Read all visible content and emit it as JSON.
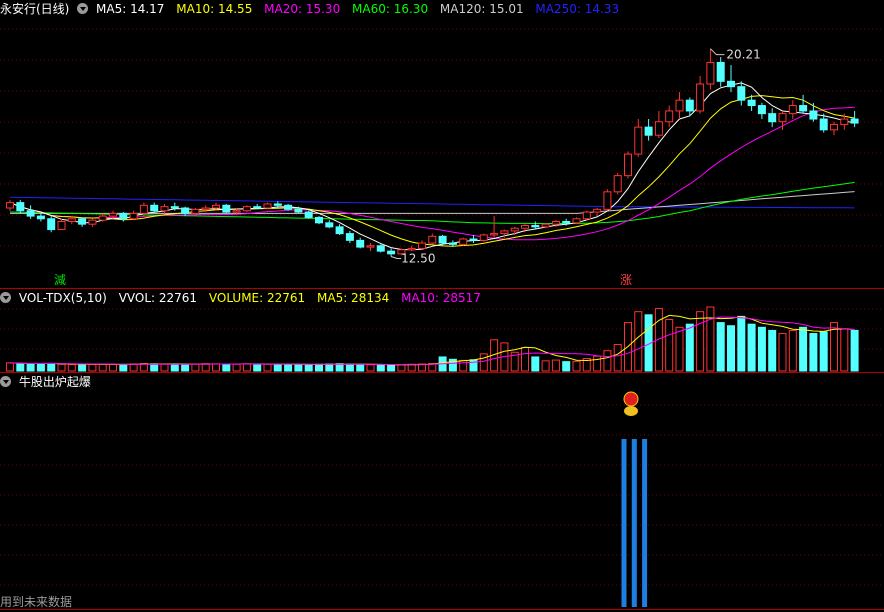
{
  "price_panel": {
    "title": "永安行(日线)",
    "indicators": [
      {
        "label": "MA5: 14.17",
        "color": "#ffffff"
      },
      {
        "label": "MA10: 14.55",
        "color": "#ffff00"
      },
      {
        "label": "MA20: 15.30",
        "color": "#ff00ff"
      },
      {
        "label": "MA60: 16.30",
        "color": "#00ff00"
      },
      {
        "label": "MA120: 15.01",
        "color": "#cccccc"
      },
      {
        "label": "MA250: 14.33",
        "color": "#2222ff"
      }
    ],
    "high_label": "20.21",
    "low_label": "12.50",
    "marker_down": "減",
    "marker_up": "涨"
  },
  "volume_panel": {
    "title": "VOL-TDX(5,10)",
    "indicators": [
      {
        "label": "VVOL: 22761",
        "color": "#ffffff"
      },
      {
        "label": "VOLUME: 22761",
        "color": "#ffff00"
      },
      {
        "label": "MA5: 28134",
        "color": "#ffff00"
      },
      {
        "label": "MA10: 28517",
        "color": "#ff00ff"
      }
    ]
  },
  "signal_panel": {
    "title": "牛股出炉起爆"
  },
  "footer_note": "用到未来数据",
  "chart_data": [
    {
      "type": "candlestick",
      "title": "永安行(日线)",
      "ylim": [
        12.0,
        21.2
      ],
      "labels": {
        "high": 20.21,
        "low": 12.5
      },
      "candles": [
        [
          14.3,
          14.6,
          14.2,
          14.5
        ],
        [
          14.5,
          14.6,
          14.1,
          14.2
        ],
        [
          14.2,
          14.4,
          13.9,
          14.0
        ],
        [
          14.0,
          14.1,
          13.8,
          13.9
        ],
        [
          13.9,
          14.0,
          13.4,
          13.5
        ],
        [
          13.5,
          13.9,
          13.5,
          13.8
        ],
        [
          13.8,
          14.0,
          13.7,
          13.9
        ],
        [
          13.9,
          13.95,
          13.6,
          13.7
        ],
        [
          13.7,
          13.9,
          13.6,
          13.85
        ],
        [
          13.85,
          14.1,
          13.8,
          14.0
        ],
        [
          14.0,
          14.2,
          13.9,
          14.1
        ],
        [
          14.1,
          14.15,
          13.8,
          13.9
        ],
        [
          13.9,
          14.2,
          13.85,
          14.1
        ],
        [
          14.1,
          14.5,
          14.0,
          14.4
        ],
        [
          14.4,
          14.5,
          14.1,
          14.2
        ],
        [
          14.2,
          14.45,
          14.1,
          14.35
        ],
        [
          14.35,
          14.5,
          14.2,
          14.3
        ],
        [
          14.3,
          14.35,
          14.0,
          14.1
        ],
        [
          14.1,
          14.3,
          14.0,
          14.25
        ],
        [
          14.25,
          14.4,
          14.15,
          14.3
        ],
        [
          14.3,
          14.5,
          14.2,
          14.4
        ],
        [
          14.4,
          14.45,
          14.1,
          14.15
        ],
        [
          14.15,
          14.3,
          14.05,
          14.2
        ],
        [
          14.2,
          14.4,
          14.15,
          14.35
        ],
        [
          14.35,
          14.45,
          14.25,
          14.3
        ],
        [
          14.3,
          14.5,
          14.25,
          14.45
        ],
        [
          14.45,
          14.55,
          14.3,
          14.4
        ],
        [
          14.4,
          14.45,
          14.2,
          14.25
        ],
        [
          14.25,
          14.35,
          14.1,
          14.15
        ],
        [
          14.15,
          14.2,
          13.9,
          13.95
        ],
        [
          13.95,
          14.0,
          13.7,
          13.75
        ],
        [
          13.75,
          13.85,
          13.55,
          13.6
        ],
        [
          13.6,
          13.7,
          13.3,
          13.35
        ],
        [
          13.35,
          13.45,
          13.0,
          13.1
        ],
        [
          13.1,
          13.2,
          12.8,
          12.85
        ],
        [
          12.85,
          13.0,
          12.7,
          12.9
        ],
        [
          12.9,
          12.95,
          12.65,
          12.7
        ],
        [
          12.7,
          12.8,
          12.5,
          12.6
        ],
        [
          12.6,
          12.8,
          12.55,
          12.75
        ],
        [
          12.75,
          12.9,
          12.7,
          12.8
        ],
        [
          12.8,
          13.1,
          12.75,
          13.0
        ],
        [
          13.0,
          13.35,
          12.95,
          13.25
        ],
        [
          13.25,
          13.3,
          12.9,
          13.0
        ],
        [
          13.0,
          13.1,
          12.85,
          12.95
        ],
        [
          12.95,
          13.2,
          12.9,
          13.15
        ],
        [
          13.15,
          13.3,
          13.0,
          13.1
        ],
        [
          13.1,
          13.35,
          13.05,
          13.3
        ],
        [
          13.3,
          14.0,
          13.2,
          13.35
        ],
        [
          13.35,
          13.5,
          13.2,
          13.45
        ],
        [
          13.45,
          13.6,
          13.3,
          13.55
        ],
        [
          13.55,
          13.7,
          13.4,
          13.65
        ],
        [
          13.65,
          13.8,
          13.5,
          13.6
        ],
        [
          13.6,
          13.75,
          13.55,
          13.7
        ],
        [
          13.7,
          13.85,
          13.6,
          13.8
        ],
        [
          13.8,
          13.9,
          13.65,
          13.75
        ],
        [
          13.75,
          13.95,
          13.7,
          13.9
        ],
        [
          13.9,
          14.2,
          13.85,
          14.15
        ],
        [
          14.15,
          14.3,
          14.0,
          14.25
        ],
        [
          14.25,
          15.0,
          14.2,
          14.9
        ],
        [
          14.9,
          15.6,
          14.8,
          15.5
        ],
        [
          15.5,
          16.4,
          15.4,
          16.3
        ],
        [
          16.3,
          17.6,
          16.2,
          17.3
        ],
        [
          17.3,
          17.6,
          16.8,
          17.0
        ],
        [
          17.0,
          17.9,
          16.9,
          17.5
        ],
        [
          17.5,
          18.1,
          17.3,
          17.9
        ],
        [
          17.9,
          18.6,
          17.6,
          18.3
        ],
        [
          18.3,
          18.4,
          17.7,
          17.9
        ],
        [
          17.9,
          19.2,
          17.8,
          18.9
        ],
        [
          18.9,
          20.21,
          18.7,
          19.7
        ],
        [
          19.7,
          19.9,
          18.8,
          19.0
        ],
        [
          19.0,
          19.6,
          18.6,
          18.8
        ],
        [
          18.8,
          19.0,
          18.1,
          18.3
        ],
        [
          18.3,
          18.5,
          17.9,
          18.1
        ],
        [
          18.1,
          18.2,
          17.6,
          17.8
        ],
        [
          17.8,
          18.0,
          17.3,
          17.5
        ],
        [
          17.5,
          17.9,
          17.2,
          17.8
        ],
        [
          17.8,
          18.3,
          17.6,
          18.1
        ],
        [
          18.1,
          18.5,
          17.8,
          17.9
        ],
        [
          17.9,
          18.2,
          17.5,
          17.6
        ],
        [
          17.6,
          17.8,
          17.1,
          17.2
        ],
        [
          17.2,
          17.5,
          17.0,
          17.4
        ],
        [
          17.4,
          17.8,
          17.2,
          17.6
        ],
        [
          17.6,
          17.9,
          17.3,
          17.45
        ]
      ]
    },
    {
      "type": "bar",
      "title": "VOL-TDX(5,10)",
      "series_name": "VOLUME",
      "values": [
        5200,
        4800,
        4500,
        4600,
        4900,
        4300,
        4100,
        4000,
        4200,
        4400,
        4300,
        4100,
        4500,
        4800,
        4600,
        4400,
        4300,
        4200,
        4500,
        4700,
        4600,
        4400,
        4300,
        4600,
        4500,
        4400,
        4300,
        4200,
        4100,
        4000,
        4300,
        4500,
        4700,
        4400,
        4200,
        4000,
        3900,
        3800,
        4100,
        4300,
        4500,
        4800,
        9000,
        7500,
        6800,
        7200,
        11000,
        20000,
        18000,
        12000,
        15000,
        9000,
        6500,
        7000,
        6000,
        6200,
        8000,
        9500,
        13000,
        17000,
        31000,
        38000,
        36000,
        40000,
        33000,
        28000,
        30000,
        38000,
        41000,
        31000,
        29000,
        35000,
        30000,
        28000,
        26000,
        24000,
        26000,
        28000,
        24000,
        25000,
        31000,
        27000,
        26000
      ]
    },
    {
      "type": "bar",
      "title": "牛股出炉起爆",
      "series_name": "signal",
      "values_by_index": {
        "60": 1,
        "61": 1,
        "62": 1
      }
    }
  ]
}
